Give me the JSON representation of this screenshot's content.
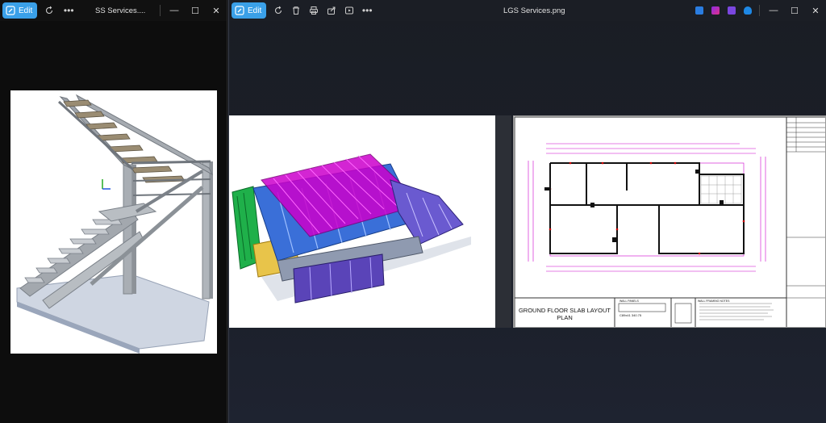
{
  "left_window": {
    "edit_label": "Edit",
    "title": "SS Services....",
    "more": "•••",
    "controls": {
      "minimize": "—",
      "maximize": "☐",
      "close": "✕"
    }
  },
  "right_window": {
    "edit_label": "Edit",
    "title": "LGS Services.png",
    "more": "•••",
    "controls": {
      "minimize": "—",
      "maximize": "☐",
      "close": "✕"
    },
    "app_icons": [
      "photos-editor-icon",
      "clipchamp-icon",
      "designer-icon",
      "onedrive-icon"
    ]
  },
  "drawing": {
    "plan_title_line1": "GROUND FLOOR SLAB LAYOUT",
    "plan_title_line2": "PLAN",
    "wall_panels_label": "WALL PANELS",
    "wall_panels_value": "C89x41 340.75",
    "notes_heading": "WALL FRAMING NOTES"
  },
  "colors": {
    "accent": "#3aa0e8",
    "frame_magenta": "#cc00cc",
    "frame_blue": "#3a6fd8",
    "frame_green": "#1fb04a",
    "steel_gray": "#b7bcc2"
  }
}
